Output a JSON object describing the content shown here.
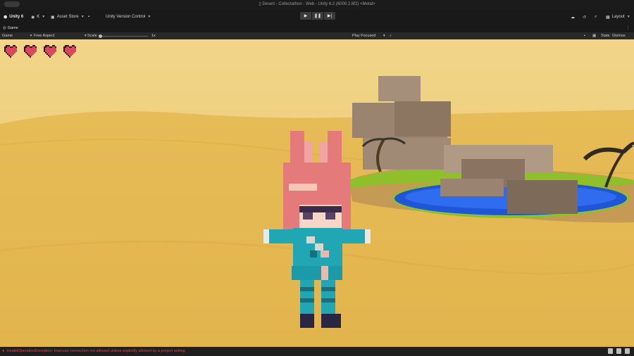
{
  "window": {
    "title": "Desert - Collectathon - Web - Unity 6.2 (6000.2.8f2) <Metal>"
  },
  "toolbar": {
    "unity_label": "Unity 6",
    "account_label": "K",
    "asset_store_label": "Asset Store",
    "version_control_label": "Unity Version Control",
    "layout_label": "Layout"
  },
  "tabs": {
    "game_tab": "Game"
  },
  "game_bar": {
    "display_value": "Game",
    "aspect_value": "Free Aspect",
    "scale_label": "Scale",
    "scale_value": "1x",
    "play_mode_value": "Play Focused",
    "stats_label": "Stats",
    "gizmos_label": "Gizmos"
  },
  "hud": {
    "hearts": 4,
    "heart_color": "#d9485f"
  },
  "status": {
    "error_text": "InvalidOperationException: Insecure connection not allowed unless explicitly allowed by a project setting"
  },
  "colors": {
    "sand": "#e7bf5d",
    "sky": "#eecf7e",
    "water": "#1f56d6",
    "grass": "#8fbf2a",
    "rock": "#a58f7b"
  }
}
